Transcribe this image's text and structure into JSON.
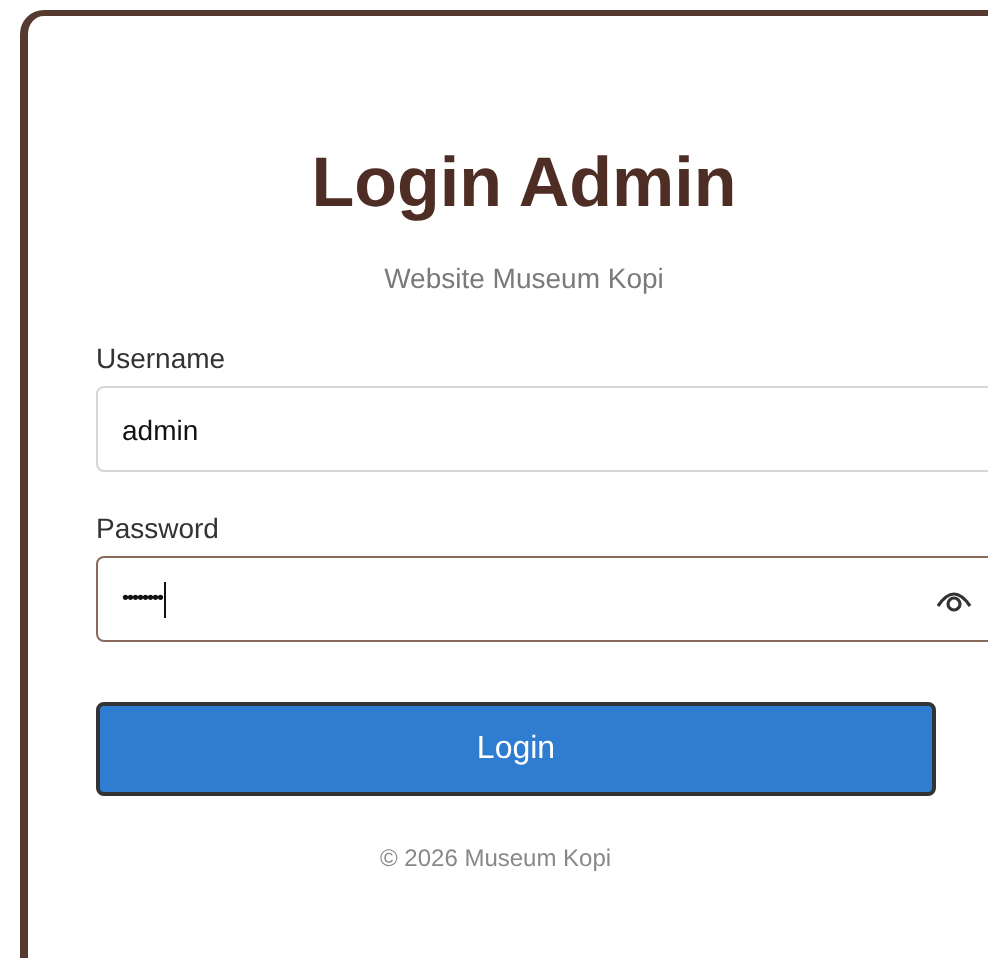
{
  "title": "Login Admin",
  "subtitle": "Website Museum Kopi",
  "fields": [
    {
      "label": "Username",
      "value": "admin",
      "focused": false,
      "kind": "text"
    },
    {
      "label": "Password",
      "value": "••••••••",
      "focused": true,
      "kind": "password"
    }
  ],
  "button": "Login",
  "footer": "© 2026 Museum Kopi"
}
